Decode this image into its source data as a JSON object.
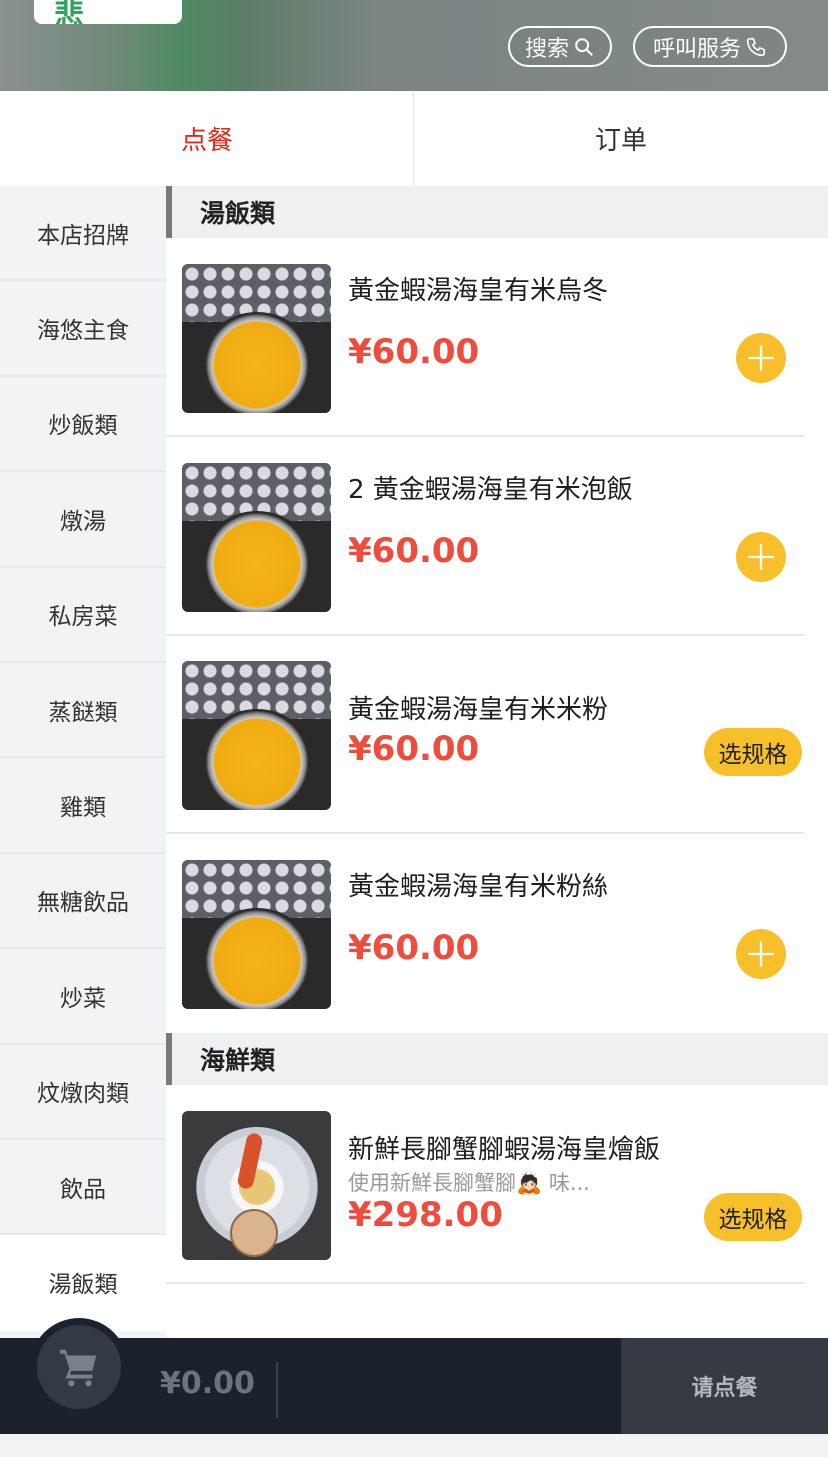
{
  "header": {
    "logo_text": "悲",
    "search_label": "搜索",
    "call_label": "呼叫服务"
  },
  "tabs": [
    {
      "label": "点餐",
      "active": true
    },
    {
      "label": "订单",
      "active": false
    }
  ],
  "sidebar": {
    "items": [
      {
        "label": "本店招牌"
      },
      {
        "label": "海悠主食"
      },
      {
        "label": "炒飯類"
      },
      {
        "label": "燉湯"
      },
      {
        "label": "私房菜"
      },
      {
        "label": "蒸餸類"
      },
      {
        "label": "雞類"
      },
      {
        "label": "無糖飲品"
      },
      {
        "label": "炒菜"
      },
      {
        "label": "炆燉肉類"
      },
      {
        "label": "飲品"
      },
      {
        "label": "湯飯類",
        "active": true
      }
    ]
  },
  "sections": [
    {
      "title": "湯飯類",
      "items": [
        {
          "name": "黃金蝦湯海皇有米烏冬",
          "price": "¥60.00",
          "action": "add",
          "action_label": ""
        },
        {
          "name": "2 黃金蝦湯海皇有米泡飯",
          "price": "¥60.00",
          "action": "add",
          "action_label": ""
        },
        {
          "name": "黃金蝦湯海皇有米米粉",
          "price": "¥60.00",
          "action": "spec",
          "action_label": "选规格"
        },
        {
          "name": "黃金蝦湯海皇有米粉絲",
          "price": "¥60.00",
          "action": "add",
          "action_label": ""
        }
      ]
    },
    {
      "title": "海鮮類",
      "items": [
        {
          "name": "新鮮長腳蟹腳蝦湯海皇燴飯",
          "desc": "使用新鮮長腳蟹腳🙇🏻 味...",
          "price": "¥298.00",
          "action": "spec",
          "action_label": "选规格"
        }
      ]
    }
  ],
  "cart": {
    "total": "¥0.00",
    "checkout_label": "请点餐"
  },
  "colors": {
    "accent_red": "#e3271d",
    "price_red": "#ee4c3d",
    "button_yellow": "#f7c02a",
    "bottom_bar": "#1c222d"
  },
  "icons": [
    "search-icon",
    "phone-icon",
    "plus-icon",
    "cart-icon"
  ]
}
